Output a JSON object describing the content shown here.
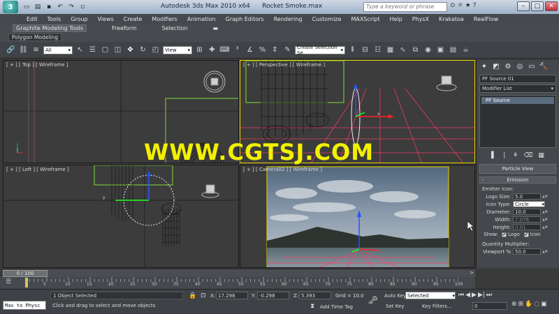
{
  "titlebar": {
    "app_title": "Autodesk 3ds Max 2010 x64",
    "file_name": "Rocket Smoke.max",
    "search_placeholder": "Type a keyword or phrase"
  },
  "menu": [
    "Edit",
    "Tools",
    "Group",
    "Views",
    "Create",
    "Modifiers",
    "Animation",
    "Graph Editors",
    "Rendering",
    "Customize",
    "MAXScript",
    "Help",
    "PhysX",
    "Krakatoa",
    "RealFlow"
  ],
  "ribbon": {
    "tabs": [
      "Graphite Modeling Tools",
      "Freeform",
      "Selection"
    ],
    "sub": "Polygon Modeling"
  },
  "toolbar": {
    "filter": "All",
    "ref_coord": "View",
    "named_selection": "Create Selection Se"
  },
  "viewports": {
    "top": "[ + ] [ Top ] [ Wireframe ]",
    "perspective": "[ + ] [ Perspective ] [ Wireframe ]",
    "left": "[ + ] [ Left ] [ Wireframe ]",
    "camera": "[ + ] [ Camera02 ] [ Wireframe ]"
  },
  "watermark": "WWW.CGTSJ.COM",
  "command_panel": {
    "object_name": "PF Source 01",
    "modifier_list": "Modifier List",
    "stack_item": "PF Source",
    "particle_view_btn": "Particle View",
    "emission_header": "Emission",
    "emitter_icon_label": "Emitter Icon:",
    "logo_size_label": "Logo Size:",
    "logo_size": "5.0",
    "icon_type_label": "Icon Type:",
    "icon_type": "Circle",
    "diameter_label": "Diameter:",
    "diameter": "10.0",
    "width_label": "Width:",
    "width": "7.076",
    "height_label": "Height:",
    "height": "0.01",
    "show_label": "Show:",
    "logo_label": "Logo",
    "icon_label": "Icon",
    "quantity_label": "Quantity Multiplier:",
    "viewport_label": "Viewport %",
    "viewport_val": "50.0"
  },
  "timeline": {
    "slider_label": "0 / 100",
    "ticks": [
      "5",
      "10",
      "15",
      "20",
      "25",
      "30",
      "35",
      "40",
      "45",
      "50",
      "55",
      "60",
      "65",
      "70",
      "75",
      "80",
      "85",
      "90",
      "95",
      "100"
    ]
  },
  "status": {
    "maxscript": "Max to Physc",
    "selected": "1 Object Selected",
    "prompt": "Click and drag to select and move objects",
    "x_label": "X:",
    "x": "17.298",
    "y_label": "Y:",
    "y": "-0.298",
    "z_label": "Z:",
    "z": "5.393",
    "grid": "Grid = 10.0",
    "add_time_tag": "Add Time Tag",
    "auto_key": "Auto Key",
    "set_key": "Set Key",
    "selected_dd": "Selected",
    "key_filters": "Key Filters...",
    "frame": "0"
  }
}
